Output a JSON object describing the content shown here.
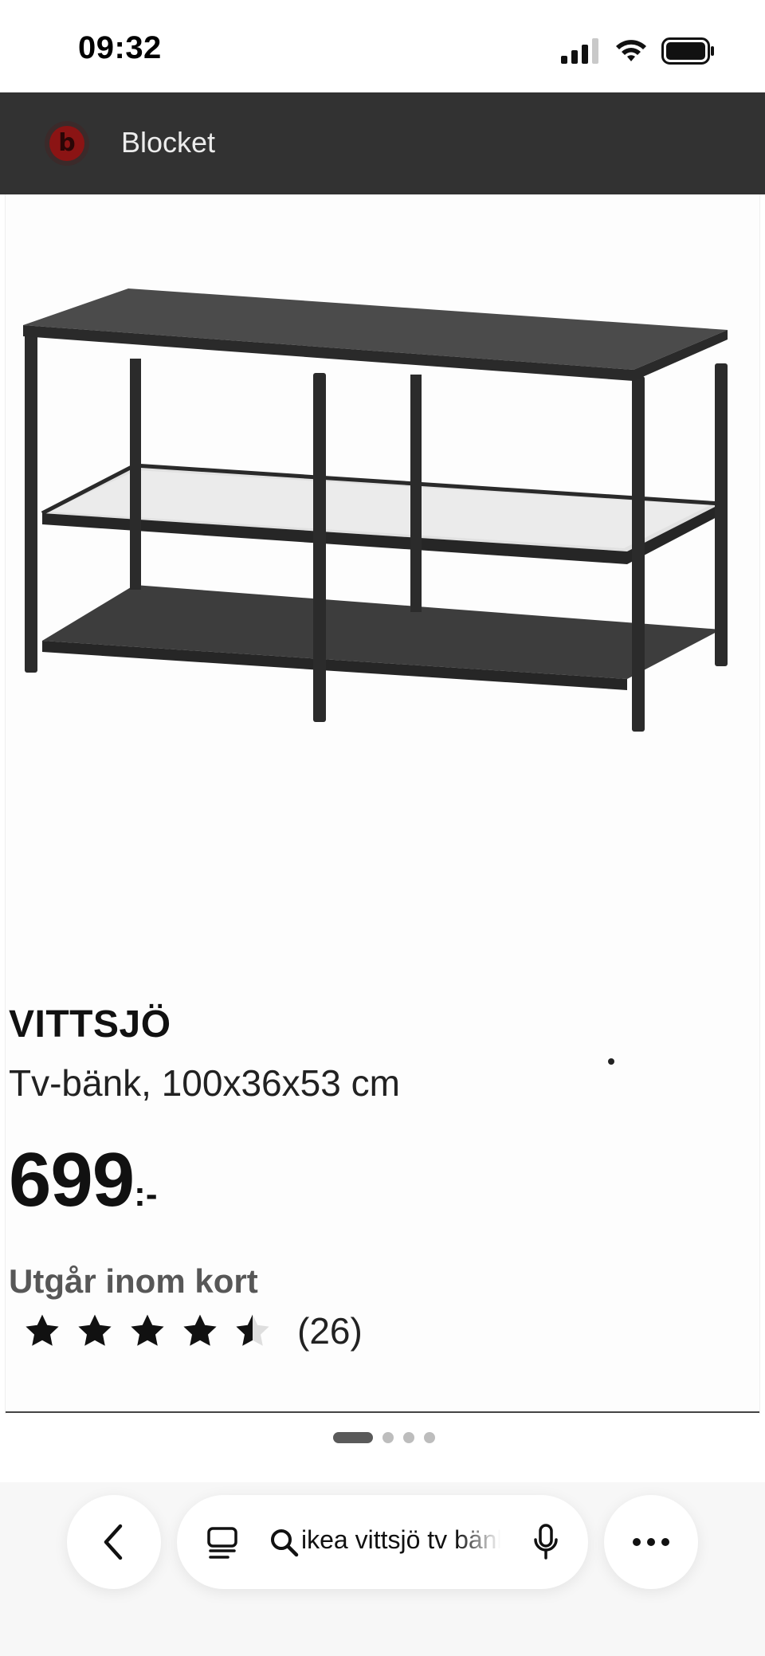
{
  "status_bar": {
    "time": "09:32",
    "signal_icon": "cellular-signal-icon",
    "wifi_icon": "wifi-icon",
    "battery_icon": "battery-icon"
  },
  "app_bar": {
    "logo_letter": "b",
    "title": "Blocket",
    "logo_color": "#8b1414",
    "background": "#323232"
  },
  "product": {
    "image_icon": "tv-bench-product-image",
    "brand": "VITTSJÖ",
    "description": "Tv-bänk, 100x36x53 cm",
    "price": "699",
    "price_suffix": ":-",
    "availability": "Utgår inom kort",
    "rating": 4.5,
    "rating_max": 5,
    "review_count": "(26)"
  },
  "pager": {
    "pages": 4,
    "active": 0
  },
  "toolbar": {
    "back_icon": "chevron-left-icon",
    "tabs_icon": "tabs-icon",
    "search_icon": "search-icon",
    "search_text": "ikea vittsjö tv bänk",
    "mic_icon": "microphone-icon",
    "more_icon": "more-dots-icon"
  }
}
